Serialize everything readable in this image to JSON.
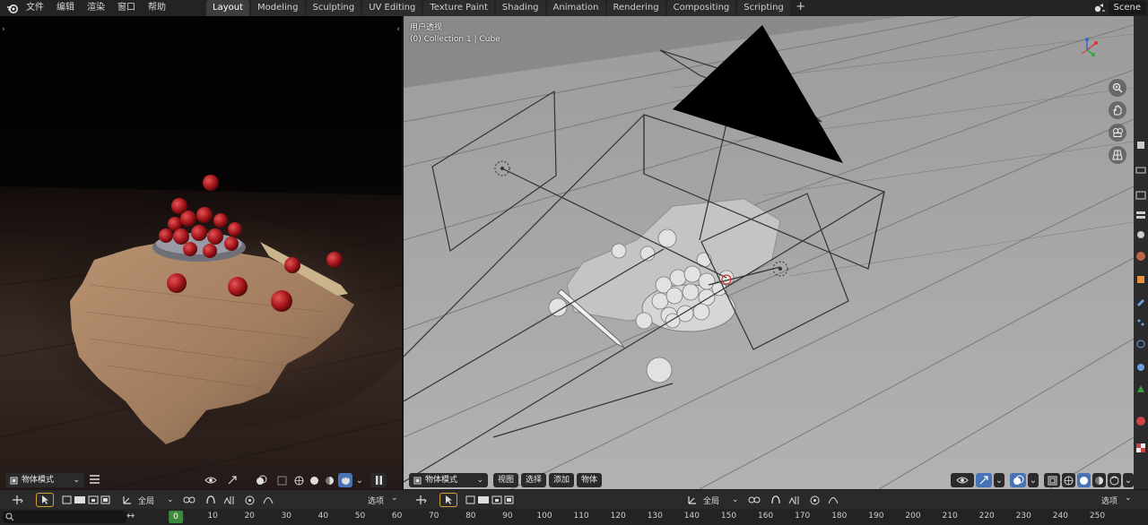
{
  "top_menu": {
    "items": [
      "文件",
      "编辑",
      "渲染",
      "窗口",
      "帮助"
    ]
  },
  "workspaces": {
    "tabs": [
      "Layout",
      "Modeling",
      "Sculpting",
      "UV Editing",
      "Texture Paint",
      "Shading",
      "Animation",
      "Rendering",
      "Compositing",
      "Scripting"
    ],
    "add": "+",
    "active": "Layout"
  },
  "scene": {
    "name": "Scene"
  },
  "left_viewport": {
    "mode": "物体模式",
    "pause_icon": "pause-icon"
  },
  "right_viewport": {
    "view_name": "用户透视",
    "collection_info": "(0) Collection 1 | Cube",
    "mode": "物体模式",
    "menus": [
      "视图",
      "选择",
      "添加",
      "物体"
    ]
  },
  "timeline_header": {
    "left_global": "全局",
    "left_options": "选项",
    "right_global": "全局",
    "right_options": "选项"
  },
  "timeline": {
    "current_frame": "0",
    "frame_labels": [
      "10",
      "20",
      "30",
      "40",
      "50",
      "60",
      "70",
      "80",
      "90",
      "100",
      "110",
      "120",
      "130",
      "140",
      "150",
      "160",
      "170",
      "180",
      "190",
      "200",
      "210",
      "220",
      "230",
      "240",
      "250"
    ]
  },
  "colors": {
    "accent": "#4772b3",
    "frame_indicator": "#3d8a3d",
    "viewport_bg": "#a9a9a9"
  }
}
